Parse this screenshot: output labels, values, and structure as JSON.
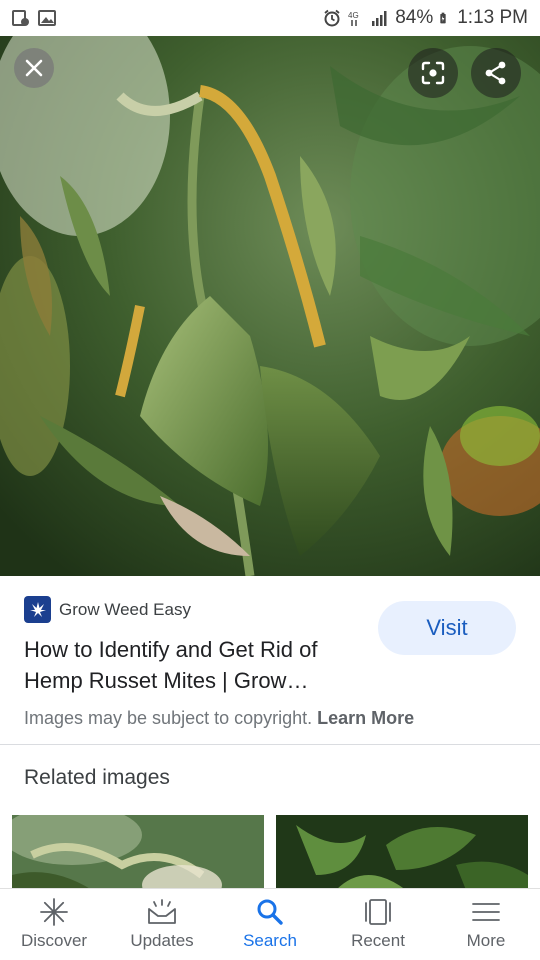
{
  "status_bar": {
    "battery": "84%",
    "time": "1:13 PM"
  },
  "hero": {
    "close_icon": "close-icon",
    "lens_icon": "lens-icon",
    "share_icon": "share-icon"
  },
  "result": {
    "source_name": "Grow Weed Easy",
    "title_line1": "How to Identify and Get Rid of",
    "title_line2": "Hemp Russet Mites | Grow…",
    "visit_label": "Visit",
    "copyright_text": "Images may be subject to copyright.",
    "learn_more": "Learn More"
  },
  "related": {
    "heading": "Related images"
  },
  "nav": {
    "items": [
      {
        "label": "Discover",
        "icon": "asterisk-icon"
      },
      {
        "label": "Updates",
        "icon": "inbox-icon"
      },
      {
        "label": "Search",
        "icon": "search-icon"
      },
      {
        "label": "Recent",
        "icon": "cards-icon"
      },
      {
        "label": "More",
        "icon": "menu-icon"
      }
    ],
    "active": "Search",
    "active_color": "#1a73e8"
  }
}
